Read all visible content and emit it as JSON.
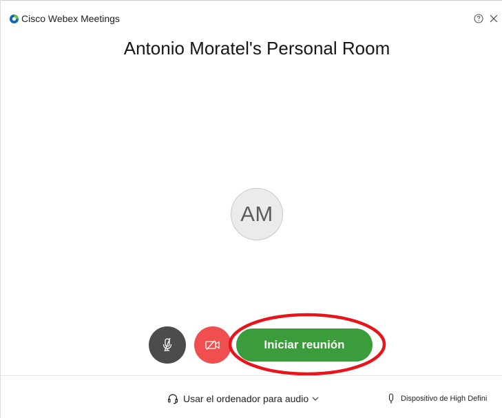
{
  "window": {
    "app_name": "Cisco Webex Meetings",
    "help_icon": "help-circle-icon",
    "close_icon": "close-icon"
  },
  "room": {
    "title": "Antonio Moratel's Personal Room"
  },
  "avatar": {
    "initials": "AM"
  },
  "controls": {
    "mute_icon": "microphone-muted-icon",
    "video_icon": "video-off-icon",
    "start_label": "Iniciar reunión"
  },
  "audio": {
    "option_label": "Usar el ordenador para audio",
    "option_icon": "headset-icon",
    "device_label": "Dispositivo de High Defini",
    "device_icon": "microphone-icon"
  },
  "colors": {
    "start_button": "#3a9c3a",
    "video_button": "#ef4f4f",
    "mute_button": "#4c4c4c",
    "annotation": "#e8141c",
    "logo_blue": "#0f67b4",
    "logo_green": "#6cc04a"
  }
}
